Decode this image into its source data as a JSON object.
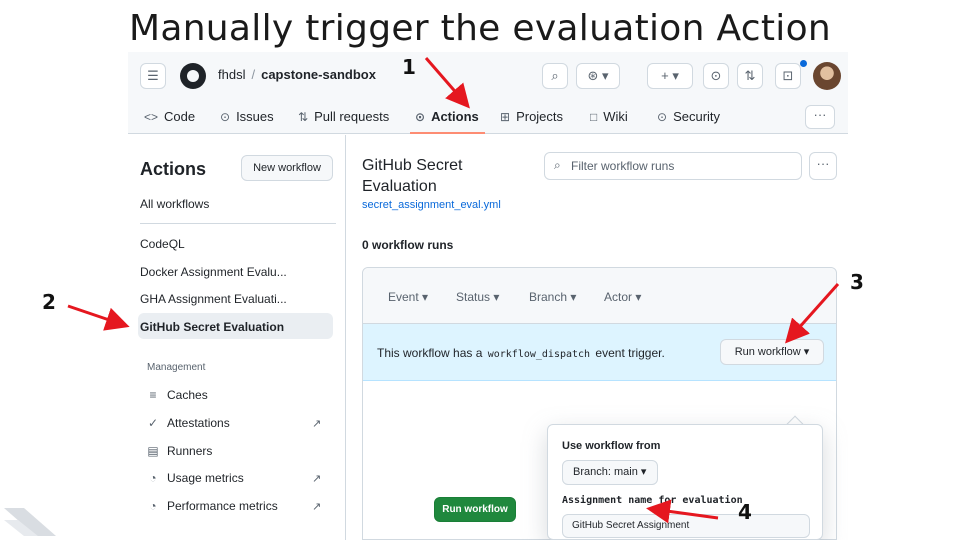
{
  "slide": {
    "title": "Manually trigger the evaluation Action"
  },
  "header": {
    "owner": "fhdsl",
    "separator": "/",
    "repo": "capstone-sandbox",
    "icons": [
      "menu-icon",
      "github-logo-icon",
      "search-icon",
      "copilot-icon",
      "plus-icon",
      "issues-icon",
      "pull-request-icon",
      "inbox-icon",
      "avatar"
    ]
  },
  "tabs": [
    {
      "icon": "code-icon",
      "glyph": "<>",
      "label": "Code"
    },
    {
      "icon": "issues-icon",
      "glyph": "⊙",
      "label": "Issues"
    },
    {
      "icon": "pull-request-icon",
      "glyph": "⇅",
      "label": "Pull requests"
    },
    {
      "icon": "play-icon",
      "glyph": "⊙",
      "label": "Actions",
      "active": true
    },
    {
      "icon": "table-icon",
      "glyph": "⊞",
      "label": "Projects"
    },
    {
      "icon": "book-icon",
      "glyph": "□",
      "label": "Wiki"
    },
    {
      "icon": "shield-icon",
      "glyph": "⊙",
      "label": "Security"
    }
  ],
  "sidebar": {
    "title": "Actions",
    "new_workflow": "New workflow",
    "all_workflows": "All workflows",
    "workflows": [
      "CodeQL",
      "Docker Assignment Evalu...",
      "GHA Assignment Evaluati...",
      "GitHub Secret Evaluation"
    ],
    "selected": "GitHub Secret Evaluation",
    "management_heading": "Management",
    "management": [
      {
        "icon": "database-icon",
        "glyph": "≡",
        "label": "Caches",
        "external": false
      },
      {
        "icon": "check-circle-icon",
        "glyph": "✓",
        "label": "Attestations",
        "external": true
      },
      {
        "icon": "server-icon",
        "glyph": "▤",
        "label": "Runners",
        "external": false
      },
      {
        "icon": "meter-icon",
        "glyph": "◔",
        "label": "Usage metrics",
        "external": true
      },
      {
        "icon": "meter-icon",
        "glyph": "◔",
        "label": "Performance metrics",
        "external": true
      }
    ],
    "external_glyph": "↗"
  },
  "main": {
    "workflow_title": "GitHub Secret Evaluation",
    "workflow_file": "secret_assignment_eval.yml",
    "filter_placeholder": "Filter workflow runs",
    "runs_count": "0 workflow runs",
    "filters": [
      "Event ▾",
      "Status ▾",
      "Branch ▾",
      "Actor ▾"
    ],
    "banner_prefix": "This workflow has a",
    "banner_code": "workflow_dispatch",
    "banner_suffix": "event trigger.",
    "run_workflow_button": "Run workflow ▾",
    "popover": {
      "use_from_label": "Use workflow from",
      "branch_button": "Branch: main ▾",
      "input_label": "Assignment name for evaluation",
      "input_value": "GitHub Secret Assignment",
      "submit_button": "Run workflow"
    }
  },
  "annotations": {
    "step1": "1",
    "step2": "2",
    "step3": "3",
    "step4": "4",
    "arrow_color": "#e5171f"
  }
}
